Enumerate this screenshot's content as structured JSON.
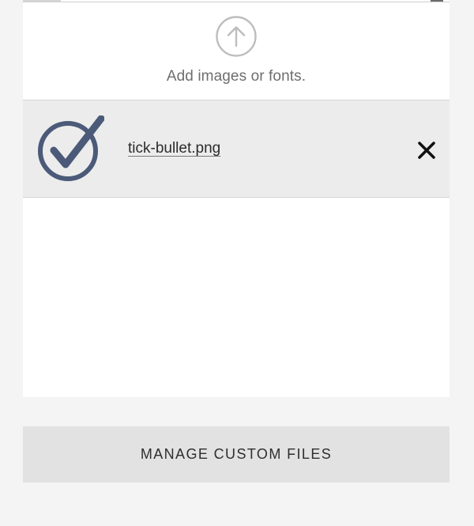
{
  "upload": {
    "label": "Add images or fonts.",
    "icon": "upload-arrow-icon"
  },
  "files": [
    {
      "name": "tick-bullet.png",
      "thumbnail_icon": "checkmark-circle-icon",
      "remove_icon": "close-icon"
    }
  ],
  "actions": {
    "manage_label": "MANAGE CUSTOM FILES"
  },
  "colors": {
    "page_background": "#f4f4f4",
    "panel_background": "#ffffff",
    "file_row_background": "#ececec",
    "button_background": "#e2e2e2",
    "thumbnail_color": "#4b5a78",
    "text_muted": "#6e6e6e",
    "text_dark": "#2b2b2b"
  }
}
